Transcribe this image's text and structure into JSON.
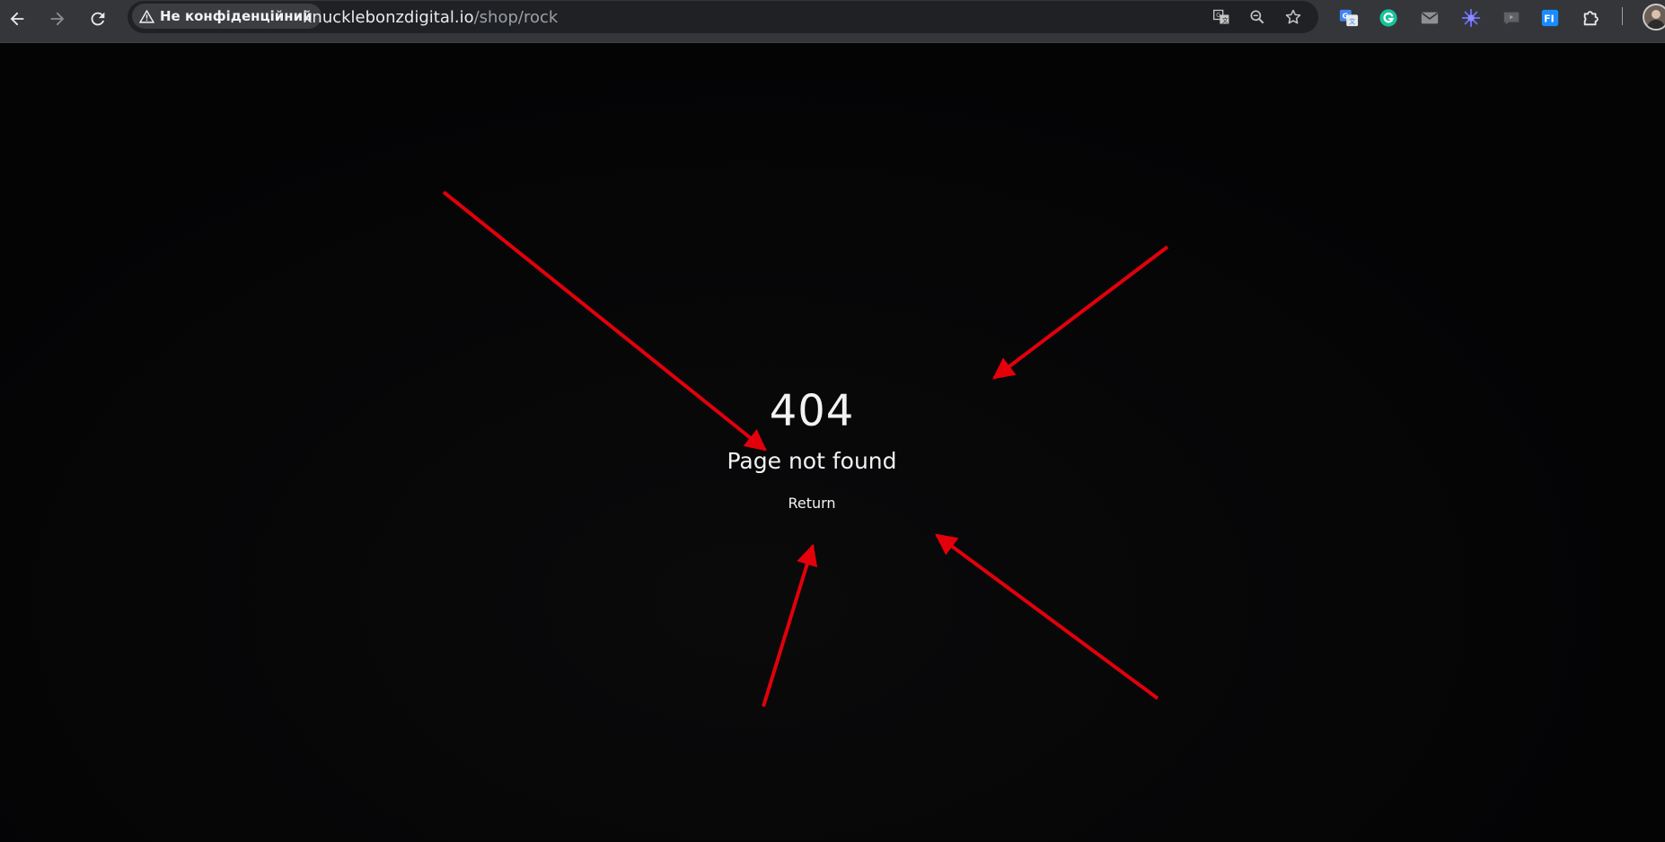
{
  "browser": {
    "security_chip": "Не конфіденційний",
    "url_domain": "knucklebonzdigital.io",
    "url_path": "/shop/rock",
    "icons": {
      "back": "back-arrow-icon",
      "forward": "forward-arrow-icon",
      "reload": "reload-icon",
      "warning": "warning-triangle-icon",
      "translate": "translate-icon",
      "zoom": "zoom-icon",
      "bookmark": "star-icon"
    },
    "extensions": [
      "google-translate-icon",
      "grammarly-icon",
      "mail-icon",
      "snowflake-icon",
      "video-icon",
      "fi-icon",
      "extensions-puzzle-icon"
    ],
    "extension_fi_text": "FI",
    "colors": {
      "toolbar": "#35363a",
      "omnibox": "#202124",
      "annotation_arrow": "#e3000b"
    }
  },
  "page": {
    "error_code": "404",
    "error_message": "Page not found",
    "return_label": "Return",
    "background": "#050506",
    "text_color": "#f2f2f2"
  }
}
